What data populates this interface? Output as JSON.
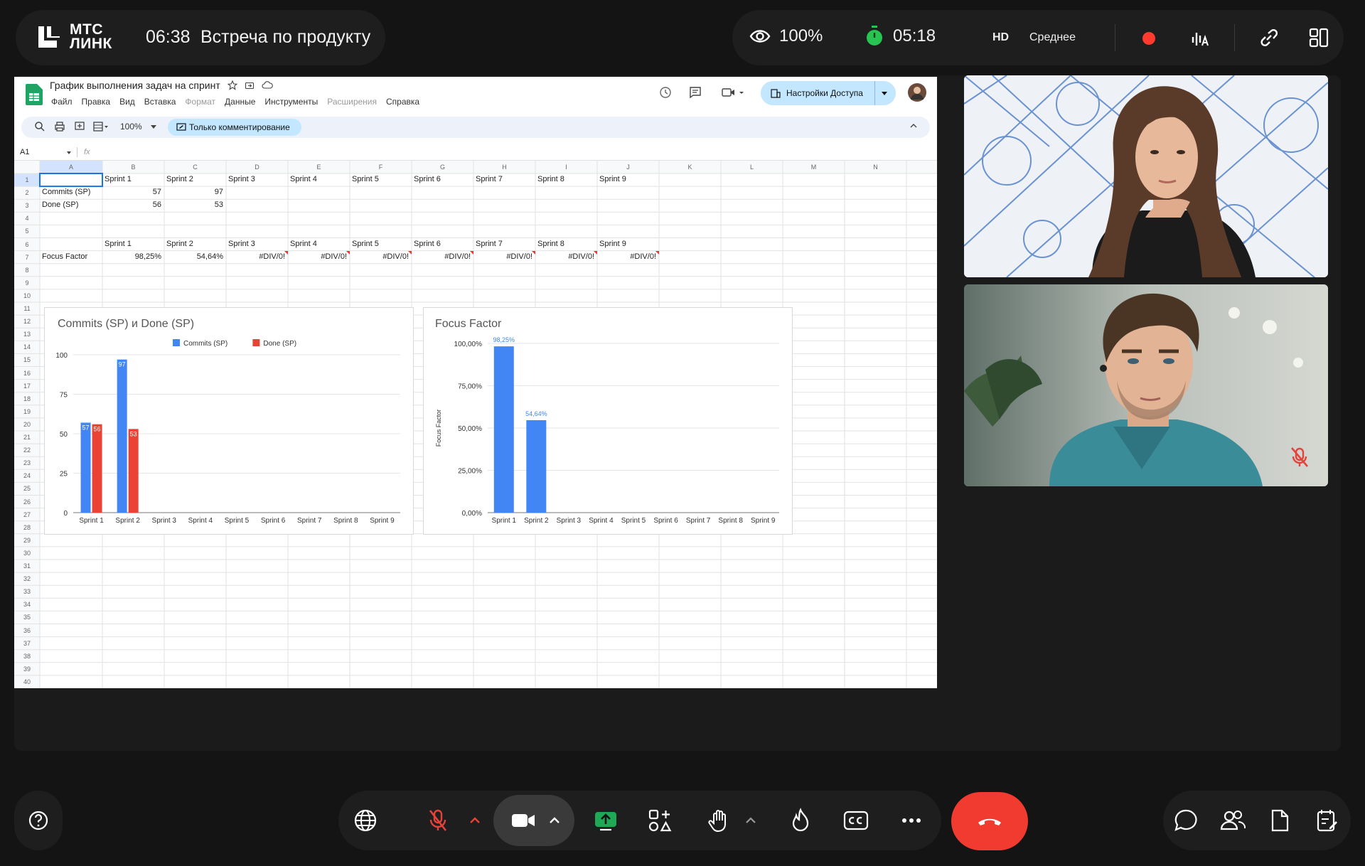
{
  "app": {
    "brand_line1": "МТС",
    "brand_line2": "ЛИНК",
    "meeting_time": "06:38",
    "meeting_title": "Встреча по продукту"
  },
  "status": {
    "viewers": "100%",
    "timer": "05:18",
    "quality_badge": "HD",
    "quality_label": "Среднее"
  },
  "sheet": {
    "title": "График выполнения задач на спринт",
    "menu": [
      "Файл",
      "Правка",
      "Вид",
      "Вставка",
      "Формат",
      "Данные",
      "Инструменты",
      "Расширения",
      "Справка"
    ],
    "menu_dimmed": [
      "Формат",
      "Расширения"
    ],
    "access_button": "Настройки Доступа",
    "zoom": "100%",
    "mode": "Только комментирование",
    "name_box": "A1",
    "fx_label": "fx",
    "columns": [
      "A",
      "B",
      "C",
      "D",
      "E",
      "F",
      "G",
      "H",
      "I",
      "J",
      "K",
      "L",
      "M",
      "N"
    ],
    "rows": {
      "r1": [
        "",
        "Sprint 1",
        "Sprint 2",
        "Sprint 3",
        "Sprint 4",
        "Sprint 5",
        "Sprint 6",
        "Sprint 7",
        "Sprint 8",
        "Sprint 9"
      ],
      "r2": [
        "Commits (SP)",
        "57",
        "97"
      ],
      "r3": [
        "Done (SP)",
        "56",
        "53"
      ],
      "r6": [
        "",
        "Sprint 1",
        "Sprint 2",
        "Sprint 3",
        "Sprint 4",
        "Sprint 5",
        "Sprint 6",
        "Sprint 7",
        "Sprint 8",
        "Sprint 9"
      ],
      "r7": [
        "Focus Factor",
        "98,25%",
        "54,64%",
        "#DIV/0!",
        "#DIV/0!",
        "#DIV/0!",
        "#DIV/0!",
        "#DIV/0!",
        "#DIV/0!",
        "#DIV/0!"
      ]
    }
  },
  "chart_data": [
    {
      "type": "bar",
      "title": "Commits (SP) и Done (SP)",
      "categories": [
        "Sprint 1",
        "Sprint 2",
        "Sprint 3",
        "Sprint 4",
        "Sprint 5",
        "Sprint 6",
        "Sprint 7",
        "Sprint 8",
        "Sprint 9"
      ],
      "series": [
        {
          "name": "Commits (SP)",
          "values": [
            57,
            97,
            null,
            null,
            null,
            null,
            null,
            null,
            null
          ],
          "color": "#4285f4"
        },
        {
          "name": "Done (SP)",
          "values": [
            56,
            53,
            null,
            null,
            null,
            null,
            null,
            null,
            null
          ],
          "color": "#ea4335"
        }
      ],
      "ylim": [
        0,
        100
      ],
      "yticks": [
        "0",
        "25",
        "50",
        "75",
        "100"
      ],
      "legend": "top",
      "grid": true
    },
    {
      "type": "bar",
      "title": "Focus Factor",
      "ylabel": "Focus Factor",
      "categories": [
        "Sprint 1",
        "Sprint 2",
        "Sprint 3",
        "Sprint 4",
        "Sprint 5",
        "Sprint 6",
        "Sprint 7",
        "Sprint 8",
        "Sprint 9"
      ],
      "series": [
        {
          "name": "Focus Factor",
          "values": [
            98.25,
            54.64,
            null,
            null,
            null,
            null,
            null,
            null,
            null
          ],
          "labels": [
            "98,25%",
            "54,64%"
          ],
          "color": "#4285f4"
        }
      ],
      "ylim": [
        0,
        100
      ],
      "yticks": [
        "0,00%",
        "25,00%",
        "50,00%",
        "75,00%",
        "100,00%"
      ],
      "grid": true
    }
  ],
  "icons": [
    "eye-icon",
    "stopwatch-icon",
    "record-dot-icon",
    "audio-level-icon",
    "link-icon",
    "layout-icon",
    "help-icon",
    "globe-icon",
    "mic-off-icon",
    "camera-icon",
    "screen-share-icon",
    "apps-icon",
    "raise-hand-icon",
    "reaction-icon",
    "captions-icon",
    "more-icon",
    "end-call-icon",
    "chat-icon",
    "participants-icon",
    "files-icon",
    "notes-icon"
  ],
  "colors": {
    "record": "#ff3b30",
    "end_call": "#f23b30",
    "timer_green": "#27c452",
    "share_green": "#1fa855",
    "mic_off_red": "#e5423a"
  }
}
